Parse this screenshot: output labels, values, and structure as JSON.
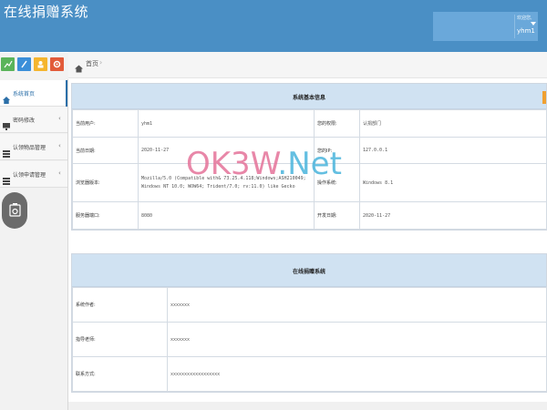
{
  "header": {
    "app_title": "在线捐赠系统",
    "user_welcome": "欢迎您,",
    "user_name": "yhm1",
    "bg_color": "#4a8fc5"
  },
  "shortcuts": [
    {
      "icon": "chart-icon",
      "color": "#5ab45a"
    },
    {
      "icon": "pencil-icon",
      "color": "#3b8fd9"
    },
    {
      "icon": "users-icon",
      "color": "#f5b52e"
    },
    {
      "icon": "gear-icon",
      "color": "#e25b3a"
    }
  ],
  "breadcrumb": {
    "home": "首页",
    "separator": "›"
  },
  "sidebar": {
    "items": [
      {
        "label": "系统首页",
        "icon": "home-icon",
        "active": true
      },
      {
        "label": "密码修改",
        "icon": "monitor-icon",
        "active": false
      },
      {
        "label": "认领物品管理",
        "icon": "list-icon",
        "active": false
      },
      {
        "label": "认领申请管理",
        "icon": "list-icon",
        "active": false
      }
    ],
    "chevron": "‹"
  },
  "system_info": {
    "title": "系统基本信息",
    "rows": [
      {
        "label1": "当前用户:",
        "value1": "yhm1",
        "label2": "您的权限:",
        "value2": "认捐部门"
      },
      {
        "label1": "当前日期:",
        "value1": "2020-11-27",
        "label2": "您的IP:",
        "value2": "127.0.0.1"
      },
      {
        "label1": "浏览器版本:",
        "value1": "Mozilla/5.0 (Compatible with& 73.25.4.118;Windows;ASH210049; Windows NT 10.0; WOW64; Trident/7.0; rv:11.0) like Gecko",
        "label2": "操作系统:",
        "value2": "Windows 8.1"
      },
      {
        "label1": "服务器端口:",
        "value1": "8080",
        "label2": "开发日期:",
        "value2": "2020-11-27"
      }
    ]
  },
  "system_about": {
    "title": "在线捐赠系统",
    "rows": [
      {
        "label": "系统作者:",
        "value": "xxxxxxx"
      },
      {
        "label": "指导老师:",
        "value": "xxxxxxx"
      },
      {
        "label": "联系方式:",
        "value": "xxxxxxxxxxxxxxxxxx"
      }
    ]
  },
  "watermark": {
    "part1": "OK3W",
    "part2": ".",
    "part3": "Net"
  }
}
